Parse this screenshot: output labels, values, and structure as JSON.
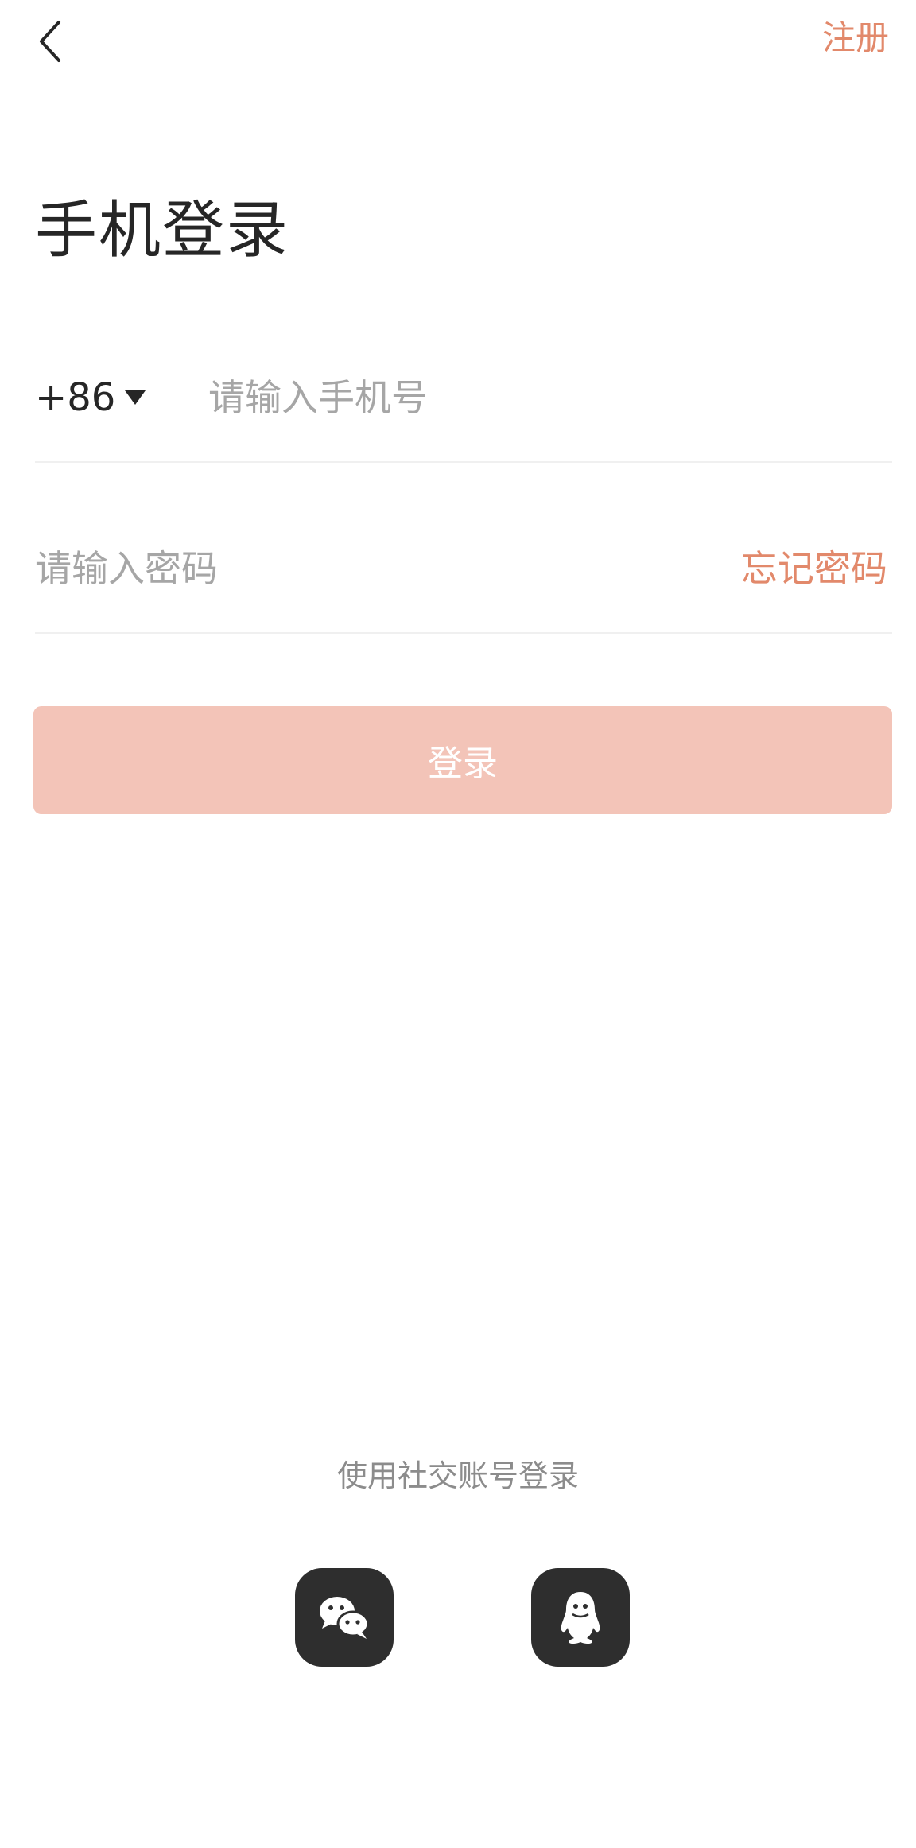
{
  "top_bar": {
    "back_icon": "chevron-left-icon",
    "register_label": "注册"
  },
  "title": "手机登录",
  "phone": {
    "country_code": "+86",
    "placeholder": "请输入手机号",
    "value": ""
  },
  "password": {
    "placeholder": "请输入密码",
    "value": "",
    "forgot_label": "忘记密码"
  },
  "login_button": {
    "label": "登录"
  },
  "social": {
    "caption": "使用社交账号登录",
    "buttons": [
      {
        "icon": "wechat-icon"
      },
      {
        "icon": "qq-icon"
      }
    ]
  },
  "colors": {
    "accent": "#e2896b",
    "button_disabled": "#f3c4b8",
    "text_primary": "#262626",
    "placeholder": "#a6a6a6",
    "social_bg": "#2e2e2e"
  }
}
